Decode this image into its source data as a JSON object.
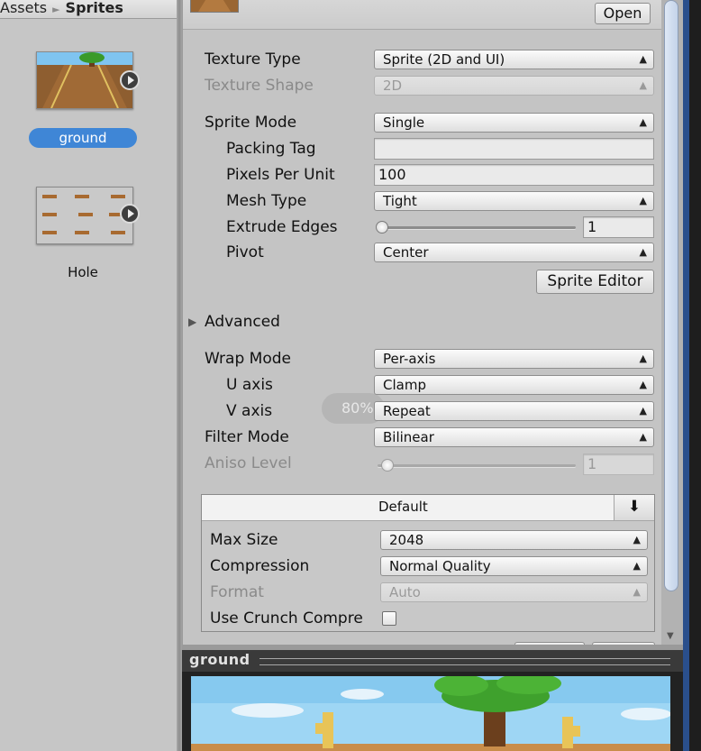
{
  "breadcrumb": {
    "parent": "Assets",
    "current": "Sprites"
  },
  "assets": [
    {
      "name": "ground",
      "selected": true
    },
    {
      "name": "Hole",
      "selected": false
    }
  ],
  "inspector": {
    "open_button": "Open",
    "rows": {
      "texture_type": {
        "label": "Texture Type",
        "value": "Sprite (2D and UI)"
      },
      "texture_shape": {
        "label": "Texture Shape",
        "value": "2D",
        "disabled": true
      },
      "sprite_mode": {
        "label": "Sprite Mode",
        "value": "Single"
      },
      "packing_tag": {
        "label": "Packing Tag",
        "value": ""
      },
      "pixels_per_unit": {
        "label": "Pixels Per Unit",
        "value": "100"
      },
      "mesh_type": {
        "label": "Mesh Type",
        "value": "Tight"
      },
      "extrude_edges": {
        "label": "Extrude Edges",
        "value": "1",
        "slider_fraction": 0.0
      },
      "pivot": {
        "label": "Pivot",
        "value": "Center"
      },
      "wrap_mode": {
        "label": "Wrap Mode",
        "value": "Per-axis"
      },
      "u_axis": {
        "label": "U axis",
        "value": "Clamp"
      },
      "v_axis": {
        "label": "V axis",
        "value": "Repeat"
      },
      "filter_mode": {
        "label": "Filter Mode",
        "value": "Bilinear"
      },
      "aniso_level": {
        "label": "Aniso Level",
        "value": "1",
        "disabled": true,
        "slider_fraction": 0.0
      }
    },
    "sprite_editor_button": "Sprite Editor",
    "advanced_label": "Advanced",
    "zoom_overlay": "80%",
    "platform": {
      "tab_label": "Default",
      "max_size": {
        "label": "Max Size",
        "value": "2048"
      },
      "compression": {
        "label": "Compression",
        "value": "Normal Quality"
      },
      "format": {
        "label": "Format",
        "value": "Auto",
        "disabled": true
      },
      "crunch": {
        "label": "Use Crunch Compre",
        "checked": false
      }
    }
  },
  "preview": {
    "title": "ground"
  },
  "icons": {
    "dropdown": "updown-arrow-icon",
    "foldout": "triangle-right-icon",
    "download": "download-arrow-icon",
    "play": "play-icon"
  },
  "colors": {
    "selection": "#3f86d6",
    "panel": "#c4c4c4",
    "preview_bar": "#3a3a3a"
  }
}
